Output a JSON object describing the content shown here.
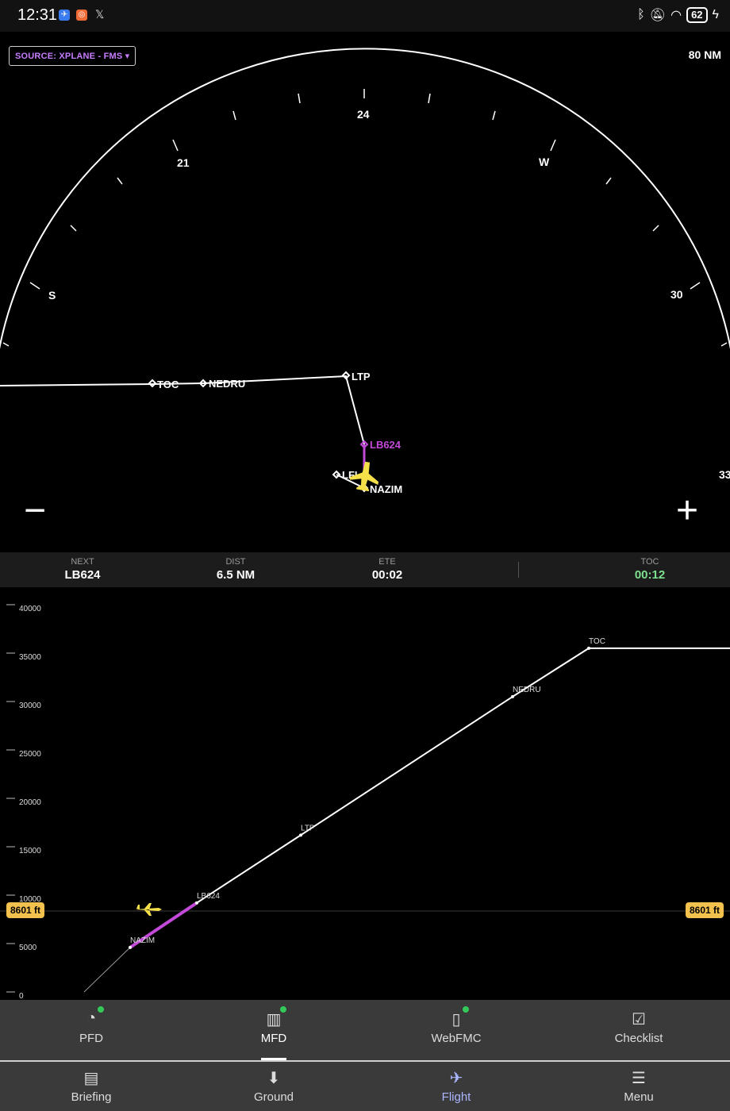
{
  "status_bar": {
    "time": "12:31",
    "app_icons": [
      {
        "name": "messenger-app-icon",
        "color": "#3b7bf0"
      },
      {
        "name": "orange-app-icon",
        "color": "#ee6b36"
      }
    ],
    "x_label": "𝕏",
    "battery": "62",
    "icons": [
      "bluetooth-icon",
      "bell-off-icon",
      "wifi-icon",
      "battery-icon",
      "charging-icon"
    ]
  },
  "map": {
    "source_label": "SOURCE: XPLANE - FMS",
    "range_label": "80 NM",
    "compass_labels": [
      "S",
      "21",
      "24",
      "W",
      "30",
      "33"
    ],
    "waypoints": [
      "TOC",
      "NEDRU",
      "LTP",
      "LB624",
      "LFI",
      "NAZIM"
    ],
    "zoom_out_label": "−",
    "zoom_in_label": "+",
    "active_color": "#c34ad8",
    "aircraft_color": "#f5e04a"
  },
  "info": {
    "next_label": "NEXT",
    "next_value": "LB624",
    "dist_label": "DIST",
    "dist_value": "6.5 NM",
    "ete_label": "ETE",
    "ete_value": "00:02",
    "toc_label": "TOC",
    "toc_value": "00:12",
    "toc_color": "#7ee08f"
  },
  "chart_data": {
    "type": "line",
    "title": "",
    "ylabel": "",
    "y_ticks": [
      "0",
      "5000",
      "10000",
      "15000",
      "20000",
      "25000",
      "30000",
      "35000",
      "40000"
    ],
    "ylim": [
      0,
      42000
    ],
    "current_altitude_label": "8601 ft",
    "current_altitude": 8601,
    "series": [
      {
        "values": [
          {
            "label": "",
            "x": 0,
            "y": 0
          },
          {
            "label": "NAZIM",
            "x": 1,
            "y": 4600
          },
          {
            "label": "LB624",
            "x": 2,
            "y": 9200
          },
          {
            "label": "LTP",
            "x": 3,
            "y": 16200
          },
          {
            "label": "NEDRU",
            "x": 4,
            "y": 30500
          },
          {
            "label": "TOC",
            "x": 5,
            "y": 35500
          },
          {
            "label": "",
            "x": 6,
            "y": 35500
          }
        ]
      }
    ]
  },
  "tabs_top": [
    {
      "label": "PFD",
      "icon": "gauge-icon",
      "status_dot": true
    },
    {
      "label": "MFD",
      "icon": "map-icon",
      "status_dot": true
    },
    {
      "label": "WebFMC",
      "icon": "remote-icon",
      "status_dot": true
    },
    {
      "label": "Checklist",
      "icon": "checklist-icon",
      "status_dot": false
    }
  ],
  "tabs_bottom": [
    {
      "label": "Briefing",
      "icon": "clipboard-icon"
    },
    {
      "label": "Ground",
      "icon": "inbox-download-icon"
    },
    {
      "label": "Flight",
      "icon": "airplane-icon"
    },
    {
      "label": "Menu",
      "icon": "hamburger-icon"
    }
  ]
}
